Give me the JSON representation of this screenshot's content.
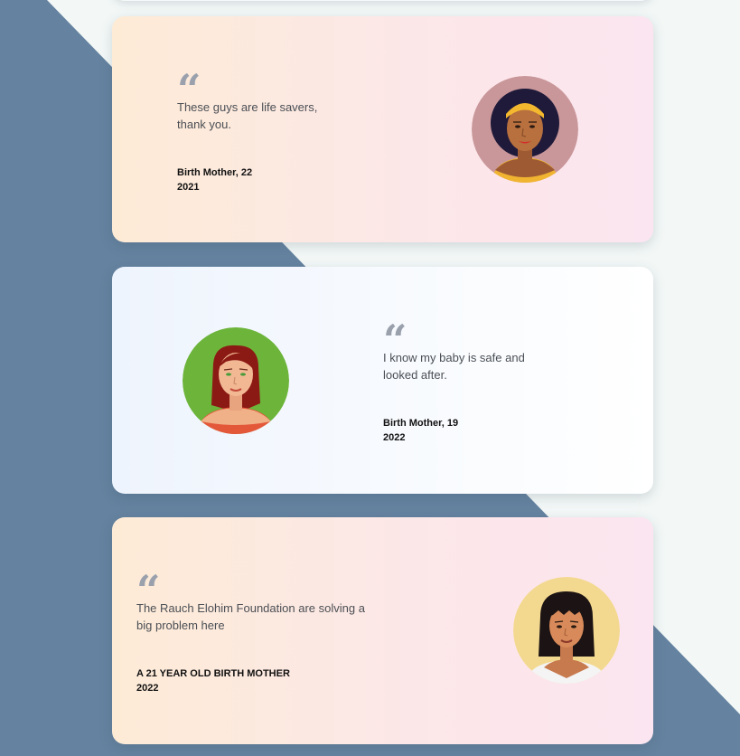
{
  "theme": {
    "background_light": "#f3f8f7",
    "background_diagonal": "#6583a0",
    "quote_mark_color": "#9aa1ad"
  },
  "testimonials": [
    {
      "quote_mark": "“",
      "text": "These guys are life savers, thank you.",
      "author": "Birth Mother, 22",
      "year": "2021",
      "avatar_icon": "woman-avatar-headband-icon",
      "avatar_bg": "#c9979a"
    },
    {
      "quote_mark": "“",
      "text": "I know my baby is safe and looked after.",
      "author": "Birth Mother, 19",
      "year": "2022",
      "avatar_icon": "woman-avatar-red-hair-icon",
      "avatar_bg": "#6cb43a"
    },
    {
      "quote_mark": "“",
      "text": "The Rauch Elohim Foundation are solving a big problem here",
      "author": "A 21 YEAR OLD BIRTH MOTHER",
      "year": "2022",
      "avatar_icon": "woman-avatar-black-hair-icon",
      "avatar_bg": "#f3d98f"
    }
  ]
}
